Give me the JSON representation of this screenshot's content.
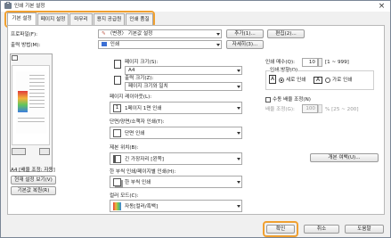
{
  "window": {
    "title": "인쇄 기본 설정",
    "close_glyph": "×"
  },
  "tabs": [
    {
      "label": "기본 설정",
      "active": true
    },
    {
      "label": "페이지 설정",
      "active": false
    },
    {
      "label": "마무리",
      "active": false
    },
    {
      "label": "용지 공급원",
      "active": false
    },
    {
      "label": "인쇄 품질",
      "active": false
    }
  ],
  "profile": {
    "label": "프로파일(F):",
    "value": "〈변경〉 기본값 설정",
    "add_button": "추가(1)...",
    "edit_button": "편집(2)..."
  },
  "output": {
    "label": "출력 방법(M):",
    "value": "인쇄",
    "details_button": "자세히(3)..."
  },
  "preview": {
    "caption": "A4 [배율 조정: 자동]",
    "view_settings_button": "현재 설정 보기(V)",
    "language_button": "기본값 복원(R)"
  },
  "page_size": {
    "label": "페이지 크기(S):",
    "value": "A4"
  },
  "output_size": {
    "label": "출력 크기(Z):",
    "value": "페이지 크기와 일치"
  },
  "layout": {
    "label": "페이지 레이아웃(L):",
    "value": "1페이지 1면 인쇄"
  },
  "duplex": {
    "label": "단면/양면/소책자 인쇄(T):",
    "value": "단면 인쇄"
  },
  "binding": {
    "label": "제본 위치(B):",
    "value": "긴 가장자리 [왼쪽]"
  },
  "jobs": {
    "label": "한 부씩 인쇄/페이지별 인쇄(H):",
    "value": "한 부씩 인쇄"
  },
  "color": {
    "label": "컬러 모드(C):",
    "value": "자동[컬러/흑백]"
  },
  "copies": {
    "label": "인쇄 매수(Q):",
    "value": "10",
    "range": "[1 ~ 999]"
  },
  "orientation": {
    "label": "인쇄 방향(O)",
    "portrait": "세로 인쇄",
    "landscape": "가로 인쇄"
  },
  "scaling": {
    "checkbox_label": "수동 배율 조정(N)",
    "label": "배율 조정(G):",
    "value": "100",
    "range": "% [25 ~ 200]"
  },
  "watermark_button": "개본 여백(U)...",
  "footer": {
    "ok": "확인",
    "cancel": "취소",
    "help": "도움말"
  },
  "colors": {
    "accent": "#f0a030",
    "select_blue": "#3b6fd4"
  }
}
